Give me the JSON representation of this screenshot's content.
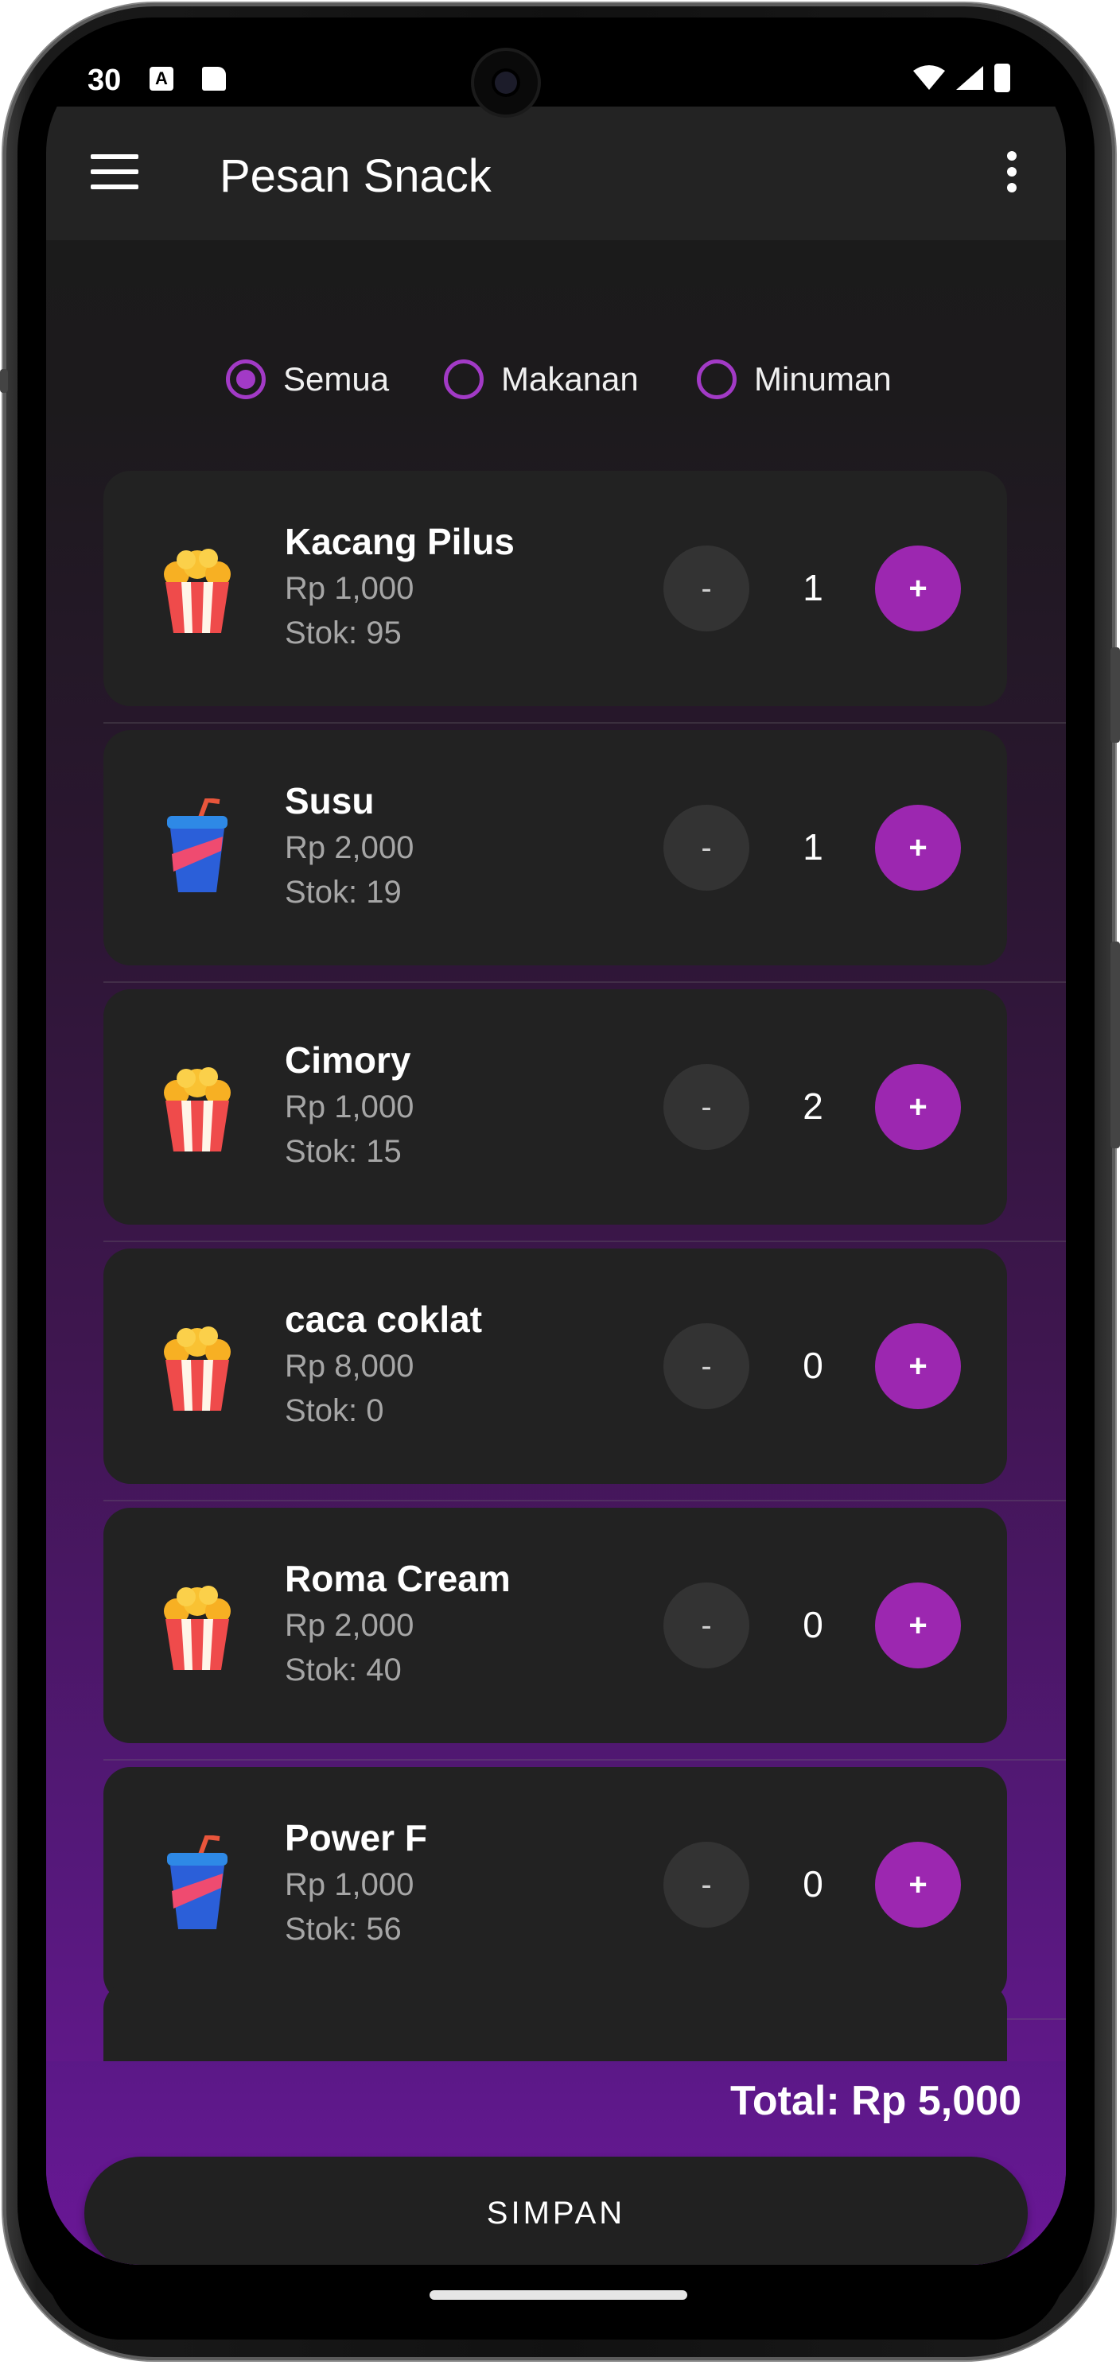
{
  "status_bar": {
    "time": "30",
    "icon_a": "A",
    "right_icons": [
      "wifi-icon",
      "signal-icon",
      "battery-icon"
    ]
  },
  "app_bar": {
    "title": "Pesan Snack",
    "menu_icon": "hamburger-menu-icon",
    "more_icon": "more-vert-icon"
  },
  "filters": {
    "options": [
      {
        "label": "Semua",
        "checked": true
      },
      {
        "label": "Makanan",
        "checked": false
      },
      {
        "label": "Minuman",
        "checked": false
      }
    ]
  },
  "items": [
    {
      "name": "Kacang Pilus",
      "price": "Rp 1,000",
      "stock": "Stok: 95",
      "qty": "1",
      "icon": "popcorn-icon",
      "minus": "-",
      "plus": "+"
    },
    {
      "name": "Susu",
      "price": "Rp 2,000",
      "stock": "Stok: 19",
      "qty": "1",
      "icon": "drink-cup-icon",
      "minus": "-",
      "plus": "+"
    },
    {
      "name": "Cimory",
      "price": "Rp 1,000",
      "stock": "Stok: 15",
      "qty": "2",
      "icon": "popcorn-icon",
      "minus": "-",
      "plus": "+"
    },
    {
      "name": "caca coklat",
      "price": "Rp 8,000",
      "stock": "Stok: 0",
      "qty": "0",
      "icon": "popcorn-icon",
      "minus": "-",
      "plus": "+"
    },
    {
      "name": "Roma Cream",
      "price": "Rp 2,000",
      "stock": "Stok: 40",
      "qty": "0",
      "icon": "popcorn-icon",
      "minus": "-",
      "plus": "+"
    },
    {
      "name": "Power F",
      "price": "Rp 1,000",
      "stock": "Stok: 56",
      "qty": "0",
      "icon": "drink-cup-icon",
      "minus": "-",
      "plus": "+"
    }
  ],
  "footer": {
    "total": "Total: Rp 5,000",
    "save_label": "SIMPAN"
  },
  "colors": {
    "accent": "#9c27b0",
    "card": "#222222",
    "app_bar": "#232323"
  }
}
